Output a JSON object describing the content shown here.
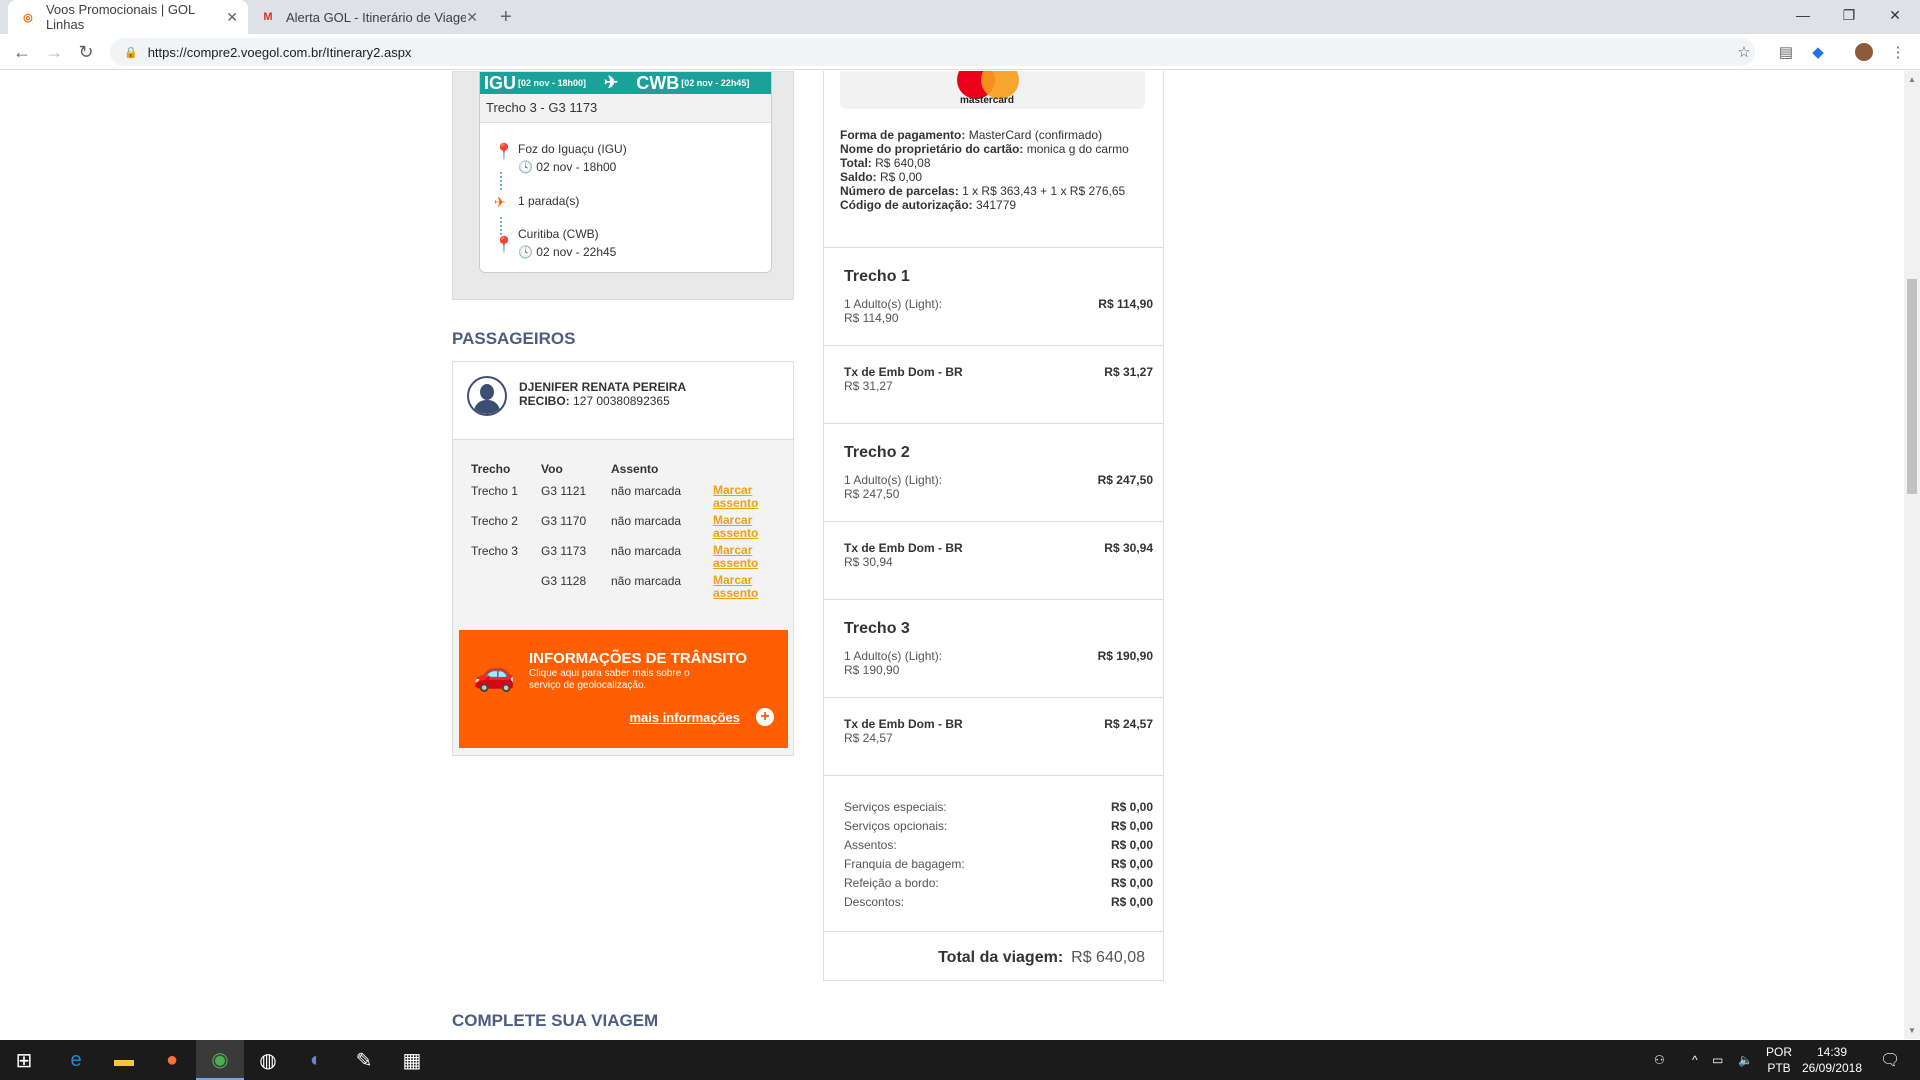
{
  "browser": {
    "tabs": [
      {
        "title": "Voos Promocionais | GOL Linhas",
        "favicon": "gol-icon",
        "active": true
      },
      {
        "title": "Alerta GOL - Itinerário de Viagem",
        "favicon": "gmail-icon",
        "active": false
      }
    ],
    "url": "https://compre2.voegol.com.br/Itinerary2.aspx"
  },
  "flight_card": {
    "origin_code": "IGU",
    "origin_time": "[02 nov - 18h00]",
    "dest_code": "CWB",
    "dest_time": "[02 nov - 22h45]",
    "segment_label": "Trecho 3 -  G3 1173",
    "origin_name": "Foz do Iguaçu (IGU)",
    "origin_datetime": "02 nov - 18h00",
    "stops": "1 parada(s)",
    "dest_name": "Curitiba (CWB)",
    "dest_datetime": "02 nov - 22h45"
  },
  "passengers": {
    "title": "PASSAGEIROS",
    "name": "DJENIFER RENATA PEREIRA",
    "receipt_label": "RECIBO:",
    "receipt_value": "127 00380892365",
    "columns": [
      "Trecho",
      "Voo",
      "Assento"
    ],
    "rows": [
      {
        "trecho": "Trecho  1",
        "voo": "G3 1121",
        "assento": "não marcada",
        "action": "Marcar assento"
      },
      {
        "trecho": "Trecho  2",
        "voo": "G3 1170",
        "assento": "não marcada",
        "action": "Marcar assento"
      },
      {
        "trecho": "Trecho  3",
        "voo": "G3 1173",
        "assento": "não marcada",
        "action": "Marcar assento"
      },
      {
        "trecho": "",
        "voo": "G3 1128",
        "assento": "não marcada",
        "action": "Marcar assento"
      }
    ],
    "transit": {
      "title": "INFORMAÇÕES DE TRÂNSITO",
      "text": "Clique aqui para saber mais sobre o serviço de geolocalização.",
      "link": "mais informações"
    }
  },
  "payment": {
    "card_brand": "mastercard",
    "method_label": "Forma de pagamento:",
    "method_value": "MasterCard (confirmado)",
    "owner_label": "Nome do proprietário do cartão:",
    "owner_value": "monica g do carmo",
    "total_label": "Total:",
    "total_value": "R$ 640,08",
    "balance_label": "Saldo:",
    "balance_value": "R$ 0,00",
    "installments_label": "Número de parcelas:",
    "installments_value": "1 x R$ 363,43 + 1 x R$ 276,65",
    "auth_label": "Código de autorização:",
    "auth_value": "341779"
  },
  "segments": [
    {
      "title": "Trecho   1",
      "fare_label": "1 Adulto(s) (Light):",
      "fare_sub": "R$ 114,90",
      "fare_value": "R$ 114,90",
      "tax_label": "Tx de Emb Dom - BR",
      "tax_sub": "R$ 31,27",
      "tax_value": "R$ 31,27"
    },
    {
      "title": "Trecho   2",
      "fare_label": "1 Adulto(s) (Light):",
      "fare_sub": "R$ 247,50",
      "fare_value": "R$ 247,50",
      "tax_label": "Tx de Emb Dom - BR",
      "tax_sub": "R$ 30,94",
      "tax_value": "R$ 30,94"
    },
    {
      "title": "Trecho   3",
      "fare_label": "1 Adulto(s) (Light):",
      "fare_sub": "R$ 190,90",
      "fare_value": "R$ 190,90",
      "tax_label": "Tx de Emb Dom - BR",
      "tax_sub": "R$ 24,57",
      "tax_value": "R$ 24,57"
    }
  ],
  "extras": [
    {
      "label": "Serviços especiais:",
      "value": "R$ 0,00"
    },
    {
      "label": "Serviços opcionais:",
      "value": "R$ 0,00"
    },
    {
      "label": "Assentos:",
      "value": "R$ 0,00"
    },
    {
      "label": "Franquia de bagagem:",
      "value": "R$ 0,00"
    },
    {
      "label": "Refeição a bordo:",
      "value": "R$ 0,00"
    },
    {
      "label": "Descontos:",
      "value": "R$ 0,00"
    }
  ],
  "trip_total": {
    "label": "Total da viagem:",
    "value": "R$ 640,08"
  },
  "complete_title": "COMPLETE SUA VIAGEM",
  "taskbar": {
    "lang1": "POR",
    "lang2": "PTB",
    "time": "14:39",
    "date": "26/09/2018"
  }
}
